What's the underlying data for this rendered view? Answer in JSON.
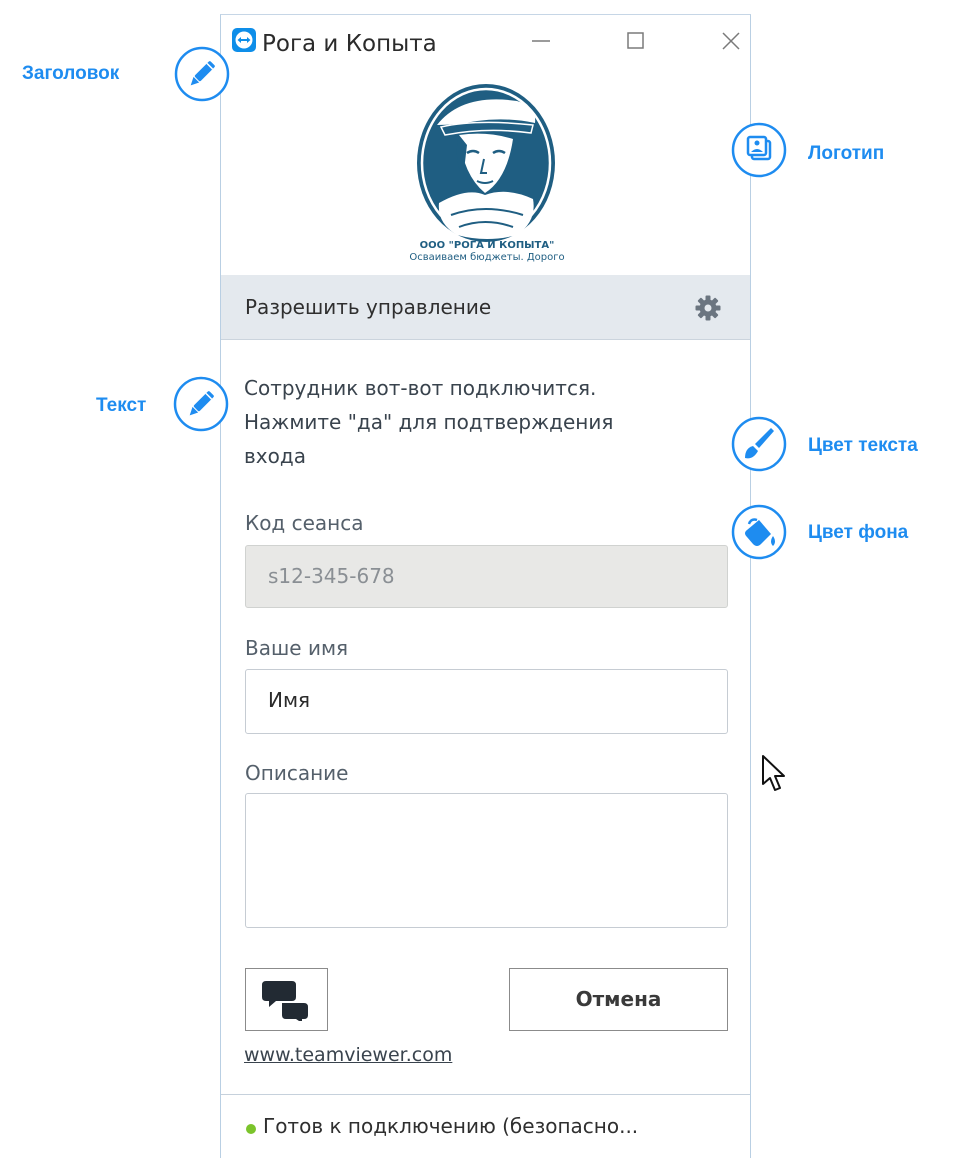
{
  "window": {
    "title": "Рога и Копыта",
    "logo": {
      "line1": "ООО \"РОГА И КОПЫТА\"",
      "line2": "Осваиваем бюджеты. Дорого"
    },
    "header": {
      "label": "Разрешить управление"
    },
    "message": {
      "line1": "Сотрудник вот-вот подключится.",
      "line2": "Нажмите \"да\" для подтверждения",
      "line3": "входа"
    },
    "session_field": {
      "label": "Код сеанса",
      "value": "s12-345-678"
    },
    "name_field": {
      "label": "Ваше имя",
      "value": "Имя"
    },
    "description_field": {
      "label": "Описание",
      "value": ""
    },
    "cancel_label": "Отмена",
    "link": "www.teamviewer.com",
    "status": "Готов к подключению (безопасно..."
  },
  "annotations": {
    "title": "Заголовок",
    "logo": "Логотип",
    "text": "Текст",
    "text_color": "Цвет текста",
    "bg_color": "Цвет фона"
  },
  "colors": {
    "accent": "#1e8cf0",
    "logo_blue": "#1f5e82",
    "header_bar": "#e4e9ee",
    "status_ok": "#7bc42b"
  },
  "icons": [
    "teamviewer-logo-icon",
    "minimize-icon",
    "maximize-icon",
    "close-icon",
    "gear-icon",
    "chat-icon",
    "pencil-icon",
    "logo-image-icon",
    "brush-icon",
    "paint-bucket-icon",
    "mouse-cursor-icon"
  ]
}
